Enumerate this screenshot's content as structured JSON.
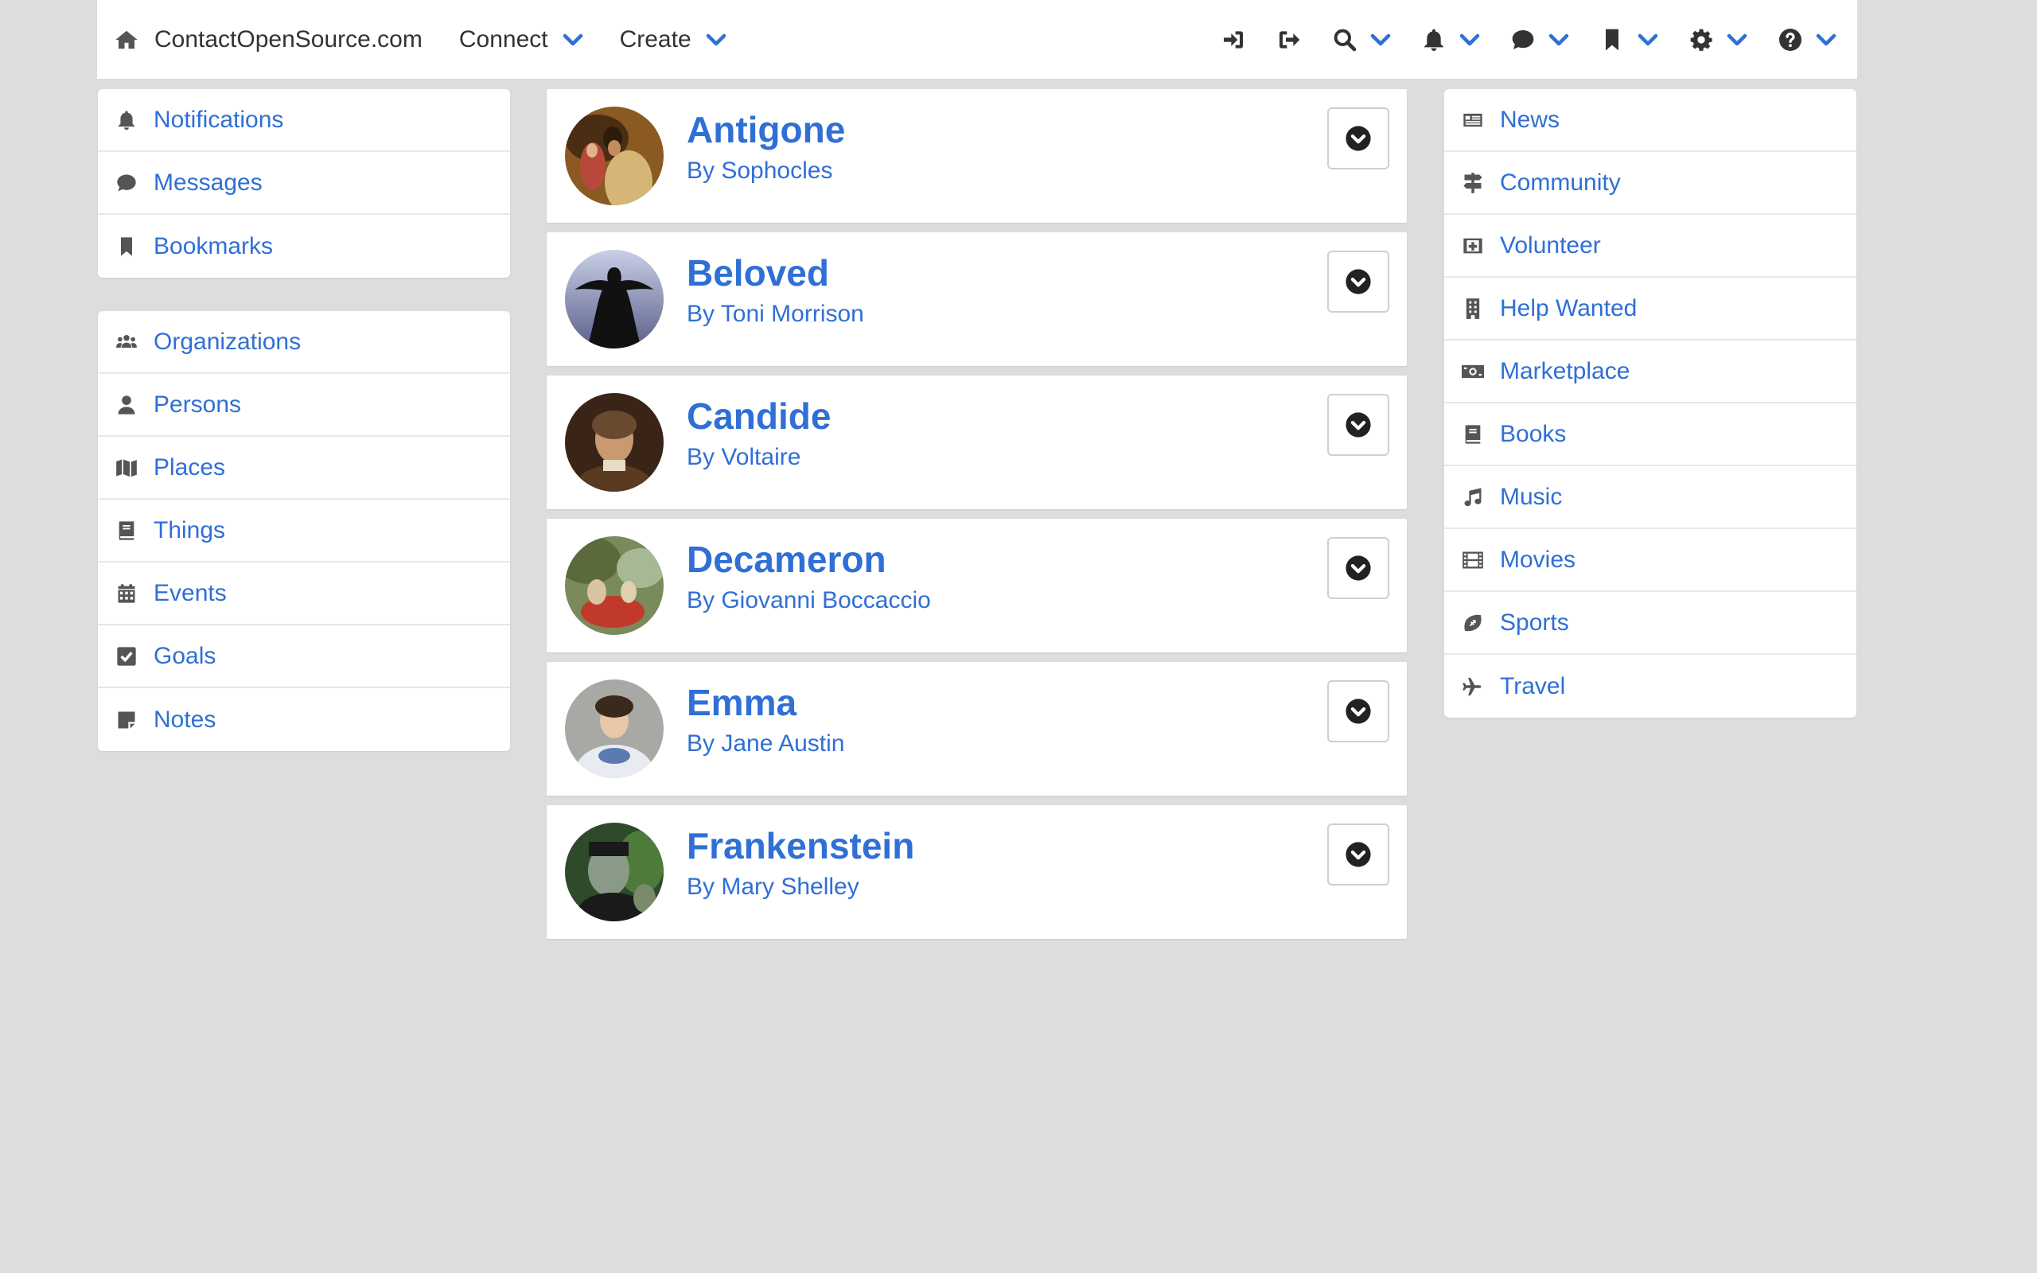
{
  "nav": {
    "brand": "ContactOpenSource.com",
    "connect": "Connect",
    "create": "Create"
  },
  "left_menu_1": [
    {
      "label": "Notifications",
      "icon": "bell-icon"
    },
    {
      "label": "Messages",
      "icon": "comment-icon"
    },
    {
      "label": "Bookmarks",
      "icon": "bookmark-icon"
    }
  ],
  "left_menu_2": [
    {
      "label": "Organizations",
      "icon": "users-icon"
    },
    {
      "label": "Persons",
      "icon": "user-icon"
    },
    {
      "label": "Places",
      "icon": "map-icon"
    },
    {
      "label": "Things",
      "icon": "book-icon"
    },
    {
      "label": "Events",
      "icon": "calendar-icon"
    },
    {
      "label": "Goals",
      "icon": "checkbox-icon"
    },
    {
      "label": "Notes",
      "icon": "note-icon"
    }
  ],
  "right_menu": [
    {
      "label": "News",
      "icon": "newspaper-icon"
    },
    {
      "label": "Community",
      "icon": "signpost-icon"
    },
    {
      "label": "Volunteer",
      "icon": "medkit-icon"
    },
    {
      "label": "Help Wanted",
      "icon": "building-icon"
    },
    {
      "label": "Marketplace",
      "icon": "money-icon"
    },
    {
      "label": "Books",
      "icon": "book-icon"
    },
    {
      "label": "Music",
      "icon": "music-icon"
    },
    {
      "label": "Movies",
      "icon": "film-icon"
    },
    {
      "label": "Sports",
      "icon": "football-icon"
    },
    {
      "label": "Travel",
      "icon": "plane-icon"
    }
  ],
  "books": [
    {
      "title": "Antigone",
      "author": "By Sophocles"
    },
    {
      "title": "Beloved",
      "author": "By Toni Morrison"
    },
    {
      "title": "Candide",
      "author": "By Voltaire"
    },
    {
      "title": "Decameron",
      "author": "By Giovanni Boccaccio"
    },
    {
      "title": "Emma",
      "author": "By Jane Austin"
    },
    {
      "title": "Frankenstein",
      "author": "By Mary Shelley"
    }
  ],
  "colors": {
    "accent": "#2f6fd6",
    "background": "#dddddd"
  }
}
